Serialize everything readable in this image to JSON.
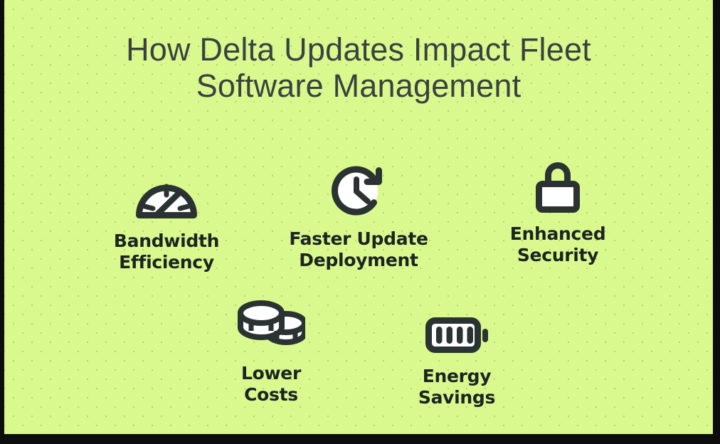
{
  "slide": {
    "background_color": "#d9f98f",
    "frame_color": "#0d0d0d",
    "title_color": "#3a4140",
    "label_color": "#1c2321",
    "icon_stroke_color": "#2b3332",
    "icon_fill_color": "#ffffff",
    "title": {
      "line1": "How Delta Updates Impact Fleet",
      "line2": "Software Management"
    },
    "features": [
      {
        "icon": "gauge-icon",
        "label_line1": "Bandwidth",
        "label_line2": "Efficiency"
      },
      {
        "icon": "clock-arrow-icon",
        "label_line1": "Faster Update",
        "label_line2": "Deployment"
      },
      {
        "icon": "padlock-icon",
        "label_line1": "Enhanced",
        "label_line2": "Security"
      },
      {
        "icon": "coins-icon",
        "label_line1": "Lower",
        "label_line2": "Costs"
      },
      {
        "icon": "battery-icon",
        "label_line1": "Energy",
        "label_line2": "Savings"
      }
    ]
  }
}
